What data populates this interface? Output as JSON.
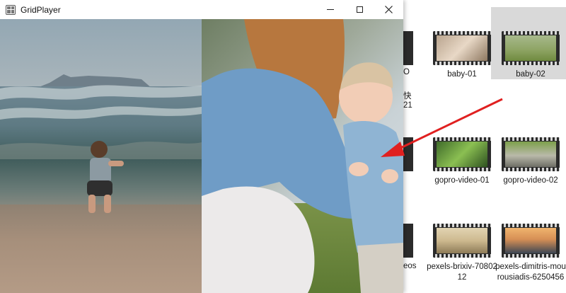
{
  "window": {
    "title": "GridPlayer"
  },
  "explorer": {
    "partial_labels": [
      "O",
      "快",
      "21",
      "eos"
    ],
    "files": [
      {
        "name": "baby-01",
        "selected": false
      },
      {
        "name": "baby-02",
        "selected": true
      },
      {
        "name": "gopro-video-01",
        "selected": false
      },
      {
        "name": "gopro-video-02",
        "selected": false
      },
      {
        "name": "pexels-brixiv-7080212",
        "selected": false
      },
      {
        "name": "pexels-dimitris-mourousiadis-6250456",
        "selected": false
      }
    ]
  },
  "colors": {
    "arrow": "#e02020",
    "selection": "#d9d9d9",
    "titlebar": "#ffffff"
  },
  "icons": {
    "app": "grid-icon",
    "minimize": "minimize-icon",
    "maximize": "maximize-icon",
    "close": "close-icon"
  }
}
